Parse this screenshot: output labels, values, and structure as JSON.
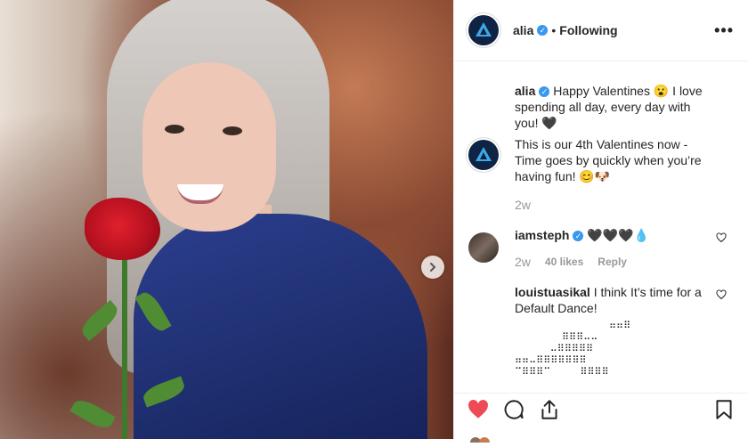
{
  "post": {
    "username": "alia",
    "separator": "•",
    "follow_status": "Following",
    "more_label": "•••"
  },
  "caption": {
    "username": "alia",
    "text": "Happy Valentines 😮 I love spending all day, every day with you! 🖤",
    "second_text": "This is our 4th Valentines now - Time goes by quickly when you’re having fun! 😊🐶",
    "time": "2w"
  },
  "comments": [
    {
      "username": "iamsteph",
      "text": "🖤🖤🖤💧",
      "time": "2w",
      "likes": "40 likes",
      "reply": "Reply"
    },
    {
      "username": "louistuasikal",
      "text": "I think It’s time for a Default Dance!",
      "ascii_art": "                ⠶⠶⠿\n        ⠿⠿⠿⠤⠤\n      ⠤⠿⠿⠿⠿⠿\n⠶⠶⠤⠿⠿⠿⠿⠿⠿⠿\n⠉⠿⠿⠿⠉     ⠿⠿⠿⠿"
    }
  ],
  "icons": {
    "next": "chevron-right-icon",
    "like": "heart-filled-icon",
    "comment": "comment-bubble-icon",
    "share": "share-icon",
    "save": "bookmark-icon"
  },
  "colors": {
    "verified": "#3897f0",
    "like_red": "#ed4956",
    "avatar_bg": "#0f2344"
  }
}
